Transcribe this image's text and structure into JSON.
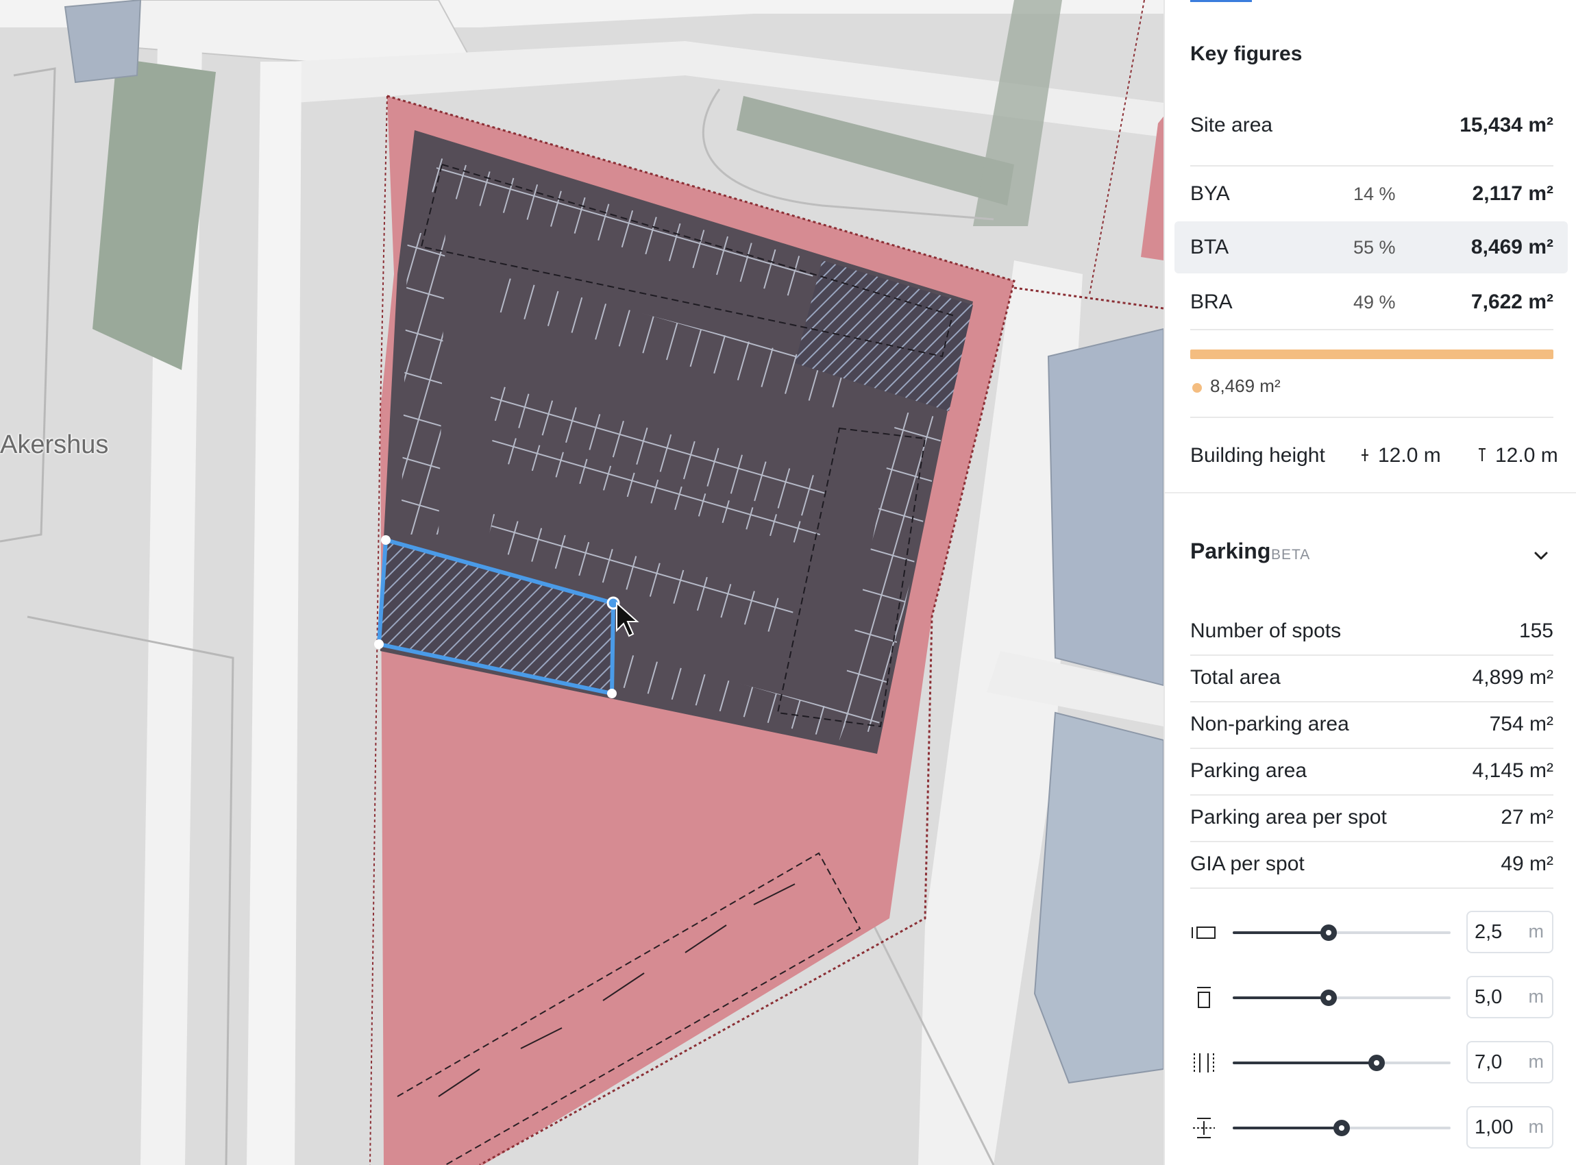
{
  "map": {
    "place_label": "Akershus"
  },
  "key_figures": {
    "title": "Key figures",
    "site_area": {
      "label": "Site area",
      "value": "15,434 m²"
    },
    "rows": [
      {
        "label": "BYA",
        "percent": "14 %",
        "value": "2,117 m²",
        "highlighted": false
      },
      {
        "label": "BTA",
        "percent": "55 %",
        "value": "8,469 m²",
        "highlighted": true
      },
      {
        "label": "BRA",
        "percent": "49 %",
        "value": "7,622 m²",
        "highlighted": false
      }
    ],
    "bar_legend_value": "8,469 m²",
    "bar_color": "#f4bd80",
    "building_height": {
      "label": "Building height",
      "min_value": "12.0 m",
      "max_value": "12.0 m"
    }
  },
  "parking": {
    "title": "Parking",
    "badge": "BETA",
    "expanded_icon": "chevron-down-icon",
    "stats": [
      {
        "label": "Number of spots",
        "value": "155"
      },
      {
        "label": "Total area",
        "value": "4,899 m²"
      },
      {
        "label": "Non-parking area",
        "value": "754 m²"
      },
      {
        "label": "Parking area",
        "value": "4,145 m²"
      },
      {
        "label": "Parking area per spot",
        "value": "27 m²"
      },
      {
        "label": "GIA per spot",
        "value": "49 m²"
      }
    ],
    "sliders": [
      {
        "icon": "spot-width-icon",
        "value": "2,5",
        "unit": "m",
        "fraction": 0.44
      },
      {
        "icon": "spot-length-icon",
        "value": "5,0",
        "unit": "m",
        "fraction": 0.44
      },
      {
        "icon": "aisle-width-icon",
        "value": "7,0",
        "unit": "m",
        "fraction": 0.66
      },
      {
        "icon": "spacing-icon",
        "value": "1,00",
        "unit": "m",
        "fraction": 0.5
      }
    ]
  },
  "colors": {
    "accent": "#3b7ddd",
    "building": "#554d57",
    "site": "#d98d94",
    "selection": "#4a9be8"
  }
}
